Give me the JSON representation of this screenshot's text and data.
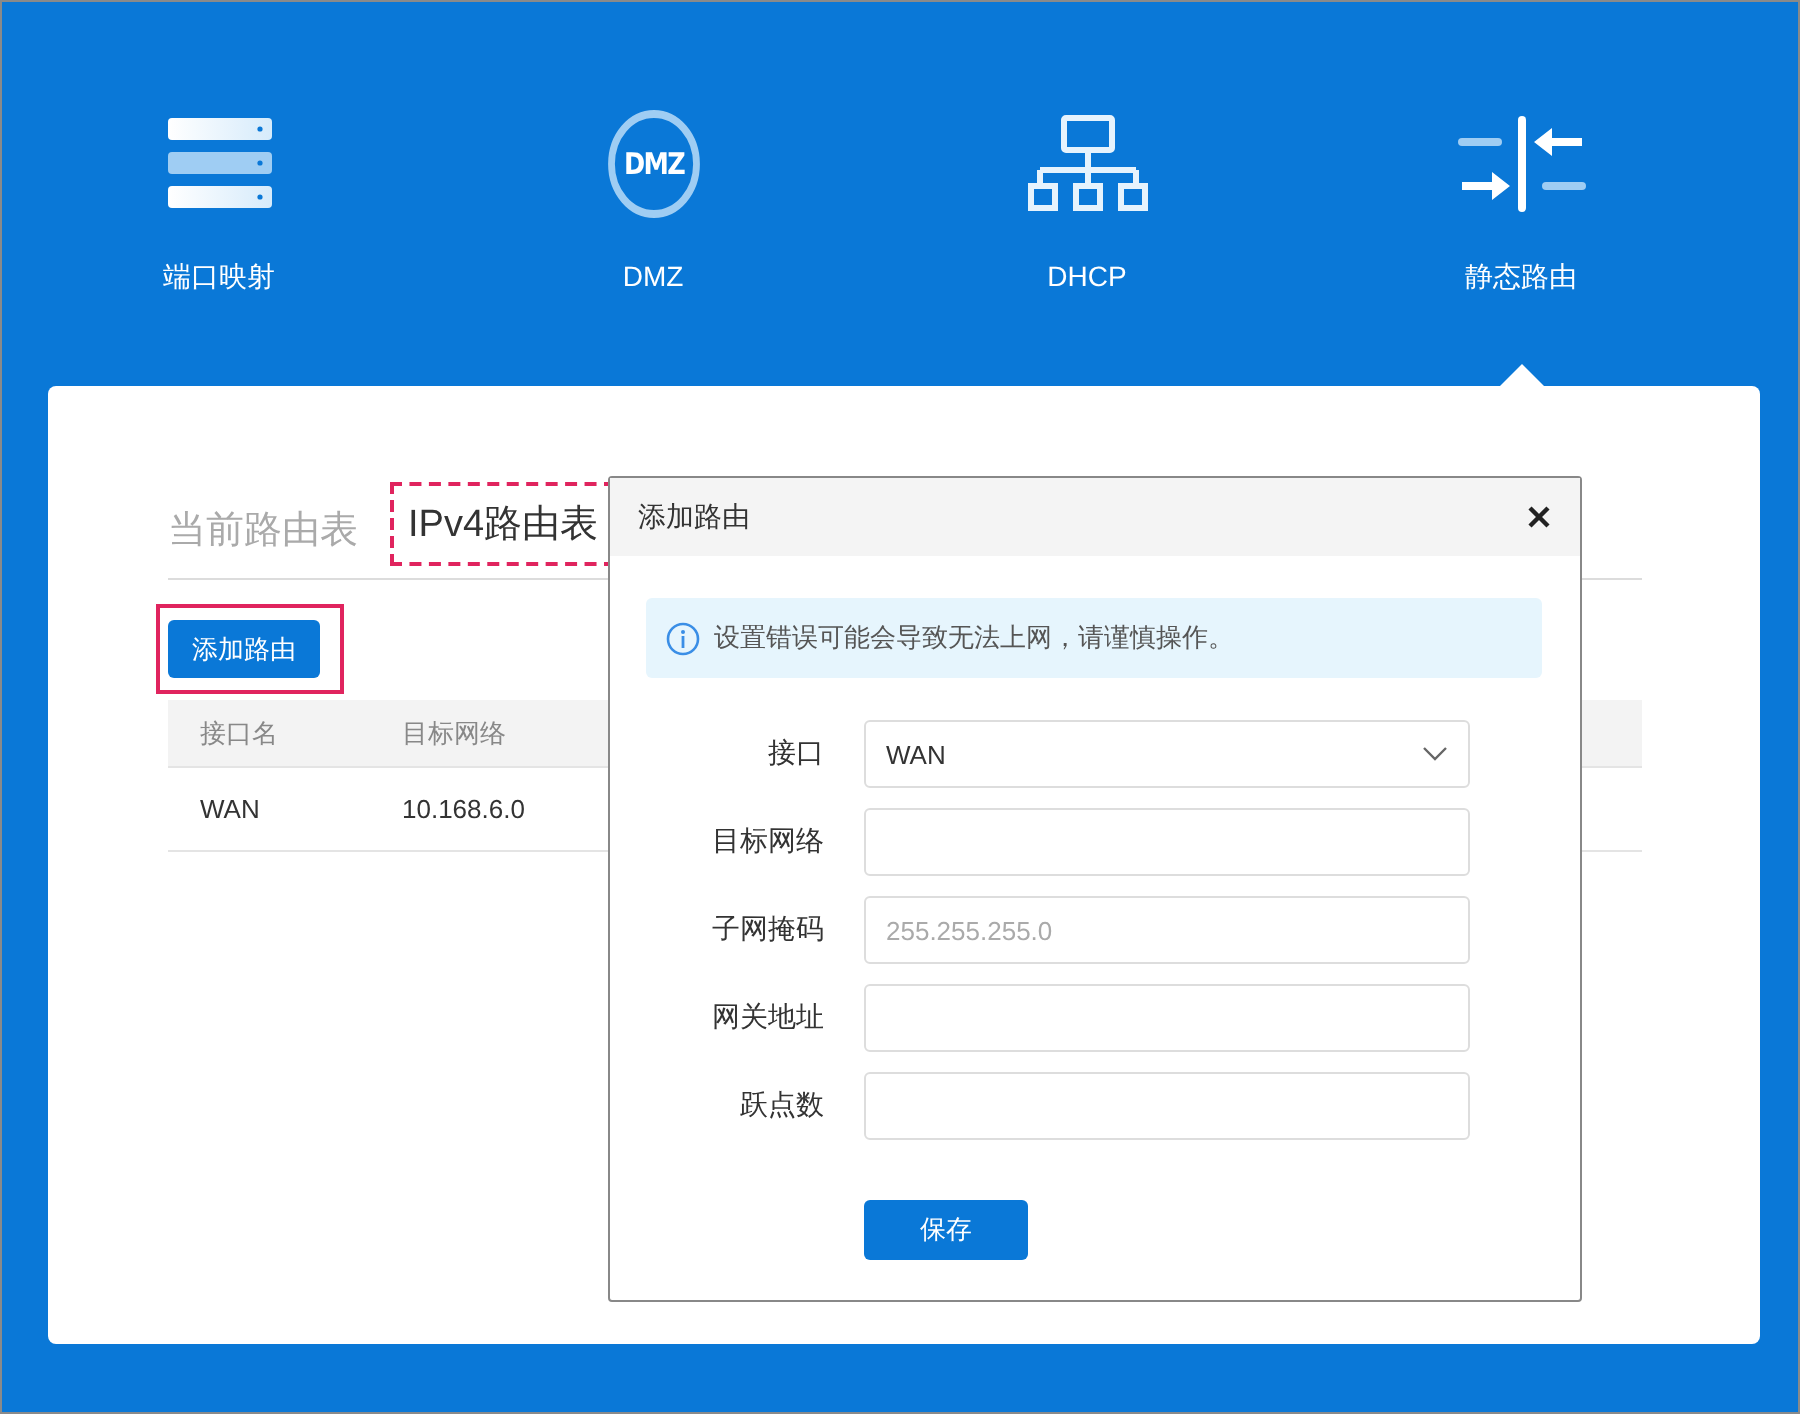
{
  "nav": {
    "items": [
      {
        "label": "端口映射",
        "selected": false
      },
      {
        "label": "DMZ",
        "icon_text": "DMZ",
        "selected": false
      },
      {
        "label": "DHCP",
        "selected": false
      },
      {
        "label": "静态路由",
        "selected": true
      }
    ]
  },
  "tabs": [
    {
      "label": "当前路由表",
      "selected": false
    },
    {
      "label": "IPv4路由表",
      "selected": true,
      "outlined": true
    }
  ],
  "add_button": {
    "label": "添加路由",
    "outlined": true
  },
  "table": {
    "columns": [
      "接口名",
      "目标网络"
    ],
    "rows": [
      [
        "WAN",
        "10.168.6.0"
      ]
    ]
  },
  "dialog": {
    "title": "添加路由",
    "alert": "设置错误可能会导致无法上网，请谨慎操作。",
    "fields": [
      {
        "label": "接口",
        "kind": "select",
        "value": "WAN"
      },
      {
        "label": "目标网络",
        "kind": "text"
      },
      {
        "label": "子网掩码",
        "kind": "text",
        "placeholder": "255.255.255.0"
      },
      {
        "label": "网关地址",
        "kind": "text"
      },
      {
        "label": "跃点数",
        "kind": "text"
      }
    ],
    "save_button": "保存"
  }
}
